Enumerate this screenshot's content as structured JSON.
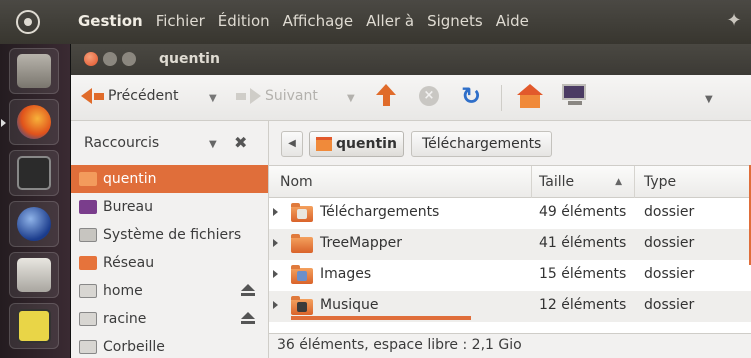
{
  "menubar": {
    "items": [
      "Gestion",
      "Fichier",
      "Édition",
      "Affichage",
      "Aller à",
      "Signets",
      "Aide"
    ]
  },
  "launcher": {
    "icons": [
      "files-icon",
      "firefox-icon",
      "terminal-icon",
      "browser-icon",
      "camera-icon",
      "drawing-icon"
    ]
  },
  "window": {
    "title": "quentin"
  },
  "toolbar": {
    "back_label": "Précédent",
    "forward_label": "Suivant"
  },
  "sidebar": {
    "title": "Raccourcis",
    "items": [
      {
        "label": "quentin",
        "icon": "home-folder-icon",
        "selected": true
      },
      {
        "label": "Bureau",
        "icon": "desktop-icon"
      },
      {
        "label": "Système de fichiers",
        "icon": "filesystem-icon"
      },
      {
        "label": "Réseau",
        "icon": "network-icon"
      },
      {
        "label": "home",
        "icon": "drive-icon",
        "eject": true
      },
      {
        "label": "racine",
        "icon": "drive-icon",
        "eject": true
      },
      {
        "label": "Corbeille",
        "icon": "trash-icon"
      }
    ]
  },
  "pathbar": {
    "crumbs": [
      "quentin",
      "Téléchargements"
    ]
  },
  "list": {
    "columns": [
      "Nom",
      "Taille",
      "Type"
    ],
    "rows": [
      {
        "name": "Téléchargements",
        "size": "49 éléments",
        "type": "dossier"
      },
      {
        "name": "TreeMapper",
        "size": "41 éléments",
        "type": "dossier"
      },
      {
        "name": "Images",
        "size": "15 éléments",
        "type": "dossier"
      },
      {
        "name": "Musique",
        "size": "12 éléments",
        "type": "dossier"
      }
    ]
  },
  "status": {
    "text": "36 éléments, espace libre : 2,1 Gio"
  },
  "colors": {
    "accent": "#e06e3a",
    "panel": "#3c3a35"
  }
}
